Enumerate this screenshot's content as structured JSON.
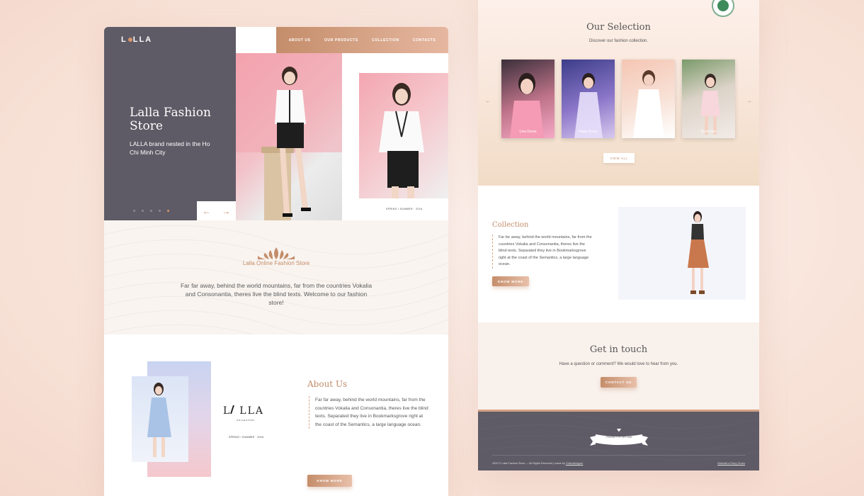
{
  "left": {
    "logo": {
      "text_a": "L",
      "text_b": "LLA"
    },
    "nav": [
      "ABOUT US",
      "OUR PRODUCTS",
      "COLLECTION",
      "CONTACTS"
    ],
    "hero": {
      "title": "Lalla Fashion Store",
      "subtitle": "LALLA brand nested in the Ho Chi Minh City",
      "caption": "SPRING / SUMMER · 2016"
    },
    "intro": {
      "brand": "Lalla Online Fashion Store",
      "text": "Far far away, behind the world mountains, far from the countries Vokalia and Consonantia, theres live the blind texts. Welcome to our fashion store!"
    },
    "about": {
      "logo_a": "L",
      "logo_b": "LLA",
      "logo_sub": "COLLECTION",
      "caption": "SPRING / SUMMER · 2016",
      "title": "About Us",
      "text": "Far far away, behind the world mountains, far from the countries Vokalia and Consonantia, theres live the blind texts. Separated they live in Bookmarksgrove right at the coast of the Semantics, a large language ocean.",
      "button": "KNOW MORE"
    }
  },
  "right": {
    "selection": {
      "title": "Our Selection",
      "subtitle": "Discover our fashion collection.",
      "cards": [
        "Lina Dress",
        "Hana Dress",
        "Tar Dress",
        "Dunn Dre"
      ],
      "button": "VIEW ALL"
    },
    "collection": {
      "title": "Collection",
      "text": "Far far away, behind the world mountains, far from the countries Vokalia and Consonantia, theres live the blind texts. Separated they live in Bookmarksgrove right at the coast of the Semantics, a large language ocean.",
      "button": "KNOW MORE"
    },
    "touch": {
      "title": "Get in touch",
      "subtitle": "Have a question or comment? We would love to hear from you.",
      "button": "CONTACT US"
    },
    "footer": {
      "ribbon_top": "NESTED IN THE HCM",
      "ribbon_bottom": "PRODUCT OF VIET NAM",
      "copyright": "2020 © Lalla Fashion Store — All Rights Reserved | made by",
      "author": "Chibodesigner",
      "links": "Website's Policy Terms"
    }
  },
  "colors": {
    "accent": "#c48d6a",
    "dark": "#5e5b66",
    "background": "#fbeae2"
  }
}
